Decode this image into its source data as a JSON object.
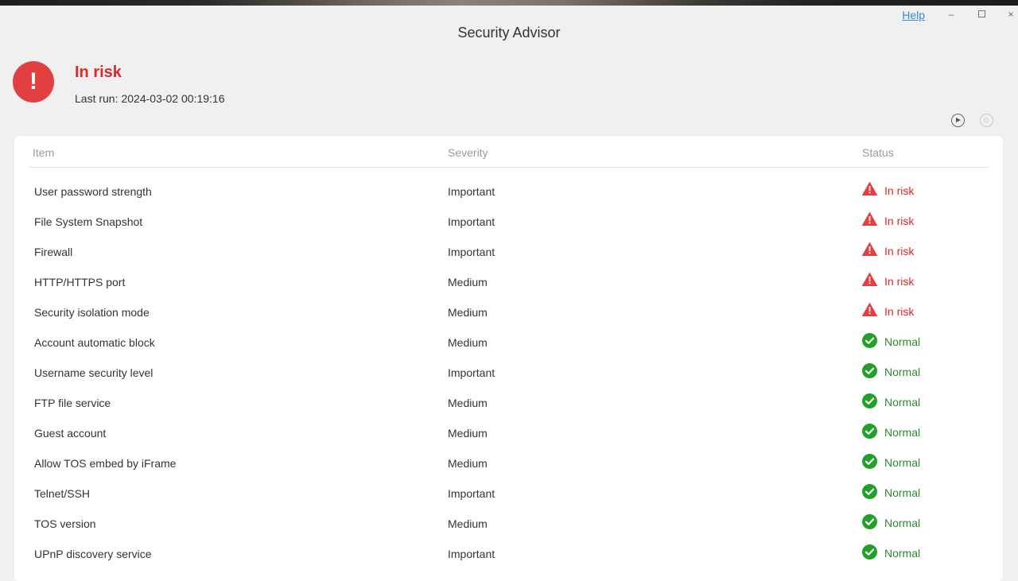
{
  "window": {
    "title": "Security Advisor",
    "help_label": "Help",
    "minimize_glyph": "–",
    "close_glyph": "×"
  },
  "summary": {
    "status": "In risk",
    "last_run_label": "Last run:",
    "last_run_value": "2024-03-02 00:19:16",
    "icon": "exclamation-icon",
    "icon_glyph": "!",
    "color": "#e23f40"
  },
  "toolbar": {
    "run_icon": "play-circle-icon",
    "settings_icon": "settings-circle-icon"
  },
  "table": {
    "headers": {
      "item": "Item",
      "severity": "Severity",
      "status": "Status"
    },
    "rows": [
      {
        "item": "User password strength",
        "severity": "Important",
        "status": "In risk",
        "state": "risk"
      },
      {
        "item": "File System Snapshot",
        "severity": "Important",
        "status": "In risk",
        "state": "risk"
      },
      {
        "item": "Firewall",
        "severity": "Important",
        "status": "In risk",
        "state": "risk"
      },
      {
        "item": "HTTP/HTTPS port",
        "severity": "Medium",
        "status": "In risk",
        "state": "risk"
      },
      {
        "item": "Security isolation mode",
        "severity": "Medium",
        "status": "In risk",
        "state": "risk"
      },
      {
        "item": "Account automatic block",
        "severity": "Medium",
        "status": "Normal",
        "state": "ok"
      },
      {
        "item": "Username security level",
        "severity": "Important",
        "status": "Normal",
        "state": "ok"
      },
      {
        "item": "FTP file service",
        "severity": "Medium",
        "status": "Normal",
        "state": "ok"
      },
      {
        "item": "Guest account",
        "severity": "Medium",
        "status": "Normal",
        "state": "ok"
      },
      {
        "item": "Allow TOS embed by iFrame",
        "severity": "Medium",
        "status": "Normal",
        "state": "ok"
      },
      {
        "item": "Telnet/SSH",
        "severity": "Important",
        "status": "Normal",
        "state": "ok"
      },
      {
        "item": "TOS version",
        "severity": "Medium",
        "status": "Normal",
        "state": "ok"
      },
      {
        "item": "UPnP discovery service",
        "severity": "Important",
        "status": "Normal",
        "state": "ok"
      }
    ]
  },
  "colors": {
    "risk": "#e02626",
    "normal": "#2a8a2a",
    "warning_icon": "#e23f40",
    "ok_icon": "#22a02a"
  }
}
